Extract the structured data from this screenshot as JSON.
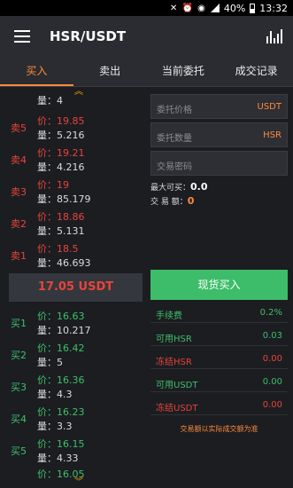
{
  "status_bar": {
    "battery": "40%",
    "time": "13:32"
  },
  "header": {
    "title": "HSR/USDT"
  },
  "tabs": [
    "买入",
    "卖出",
    "当前委托",
    "成交记录"
  ],
  "order_book": {
    "partial_top_qty": "量：4",
    "asks": [
      {
        "side": "卖5",
        "price": "价：19.85",
        "qty": "量：5.216"
      },
      {
        "side": "卖4",
        "price": "价：19.21",
        "qty": "量：4.216"
      },
      {
        "side": "卖3",
        "price": "价：19",
        "qty": "量：85.179"
      },
      {
        "side": "卖2",
        "price": "价：18.86",
        "qty": "量：5.131"
      },
      {
        "side": "卖1",
        "price": "价：18.5",
        "qty": "量：46.693"
      }
    ],
    "last_price": "17.05 USDT",
    "bids": [
      {
        "side": "买1",
        "price": "价：16.63",
        "qty": "量：10.217"
      },
      {
        "side": "买2",
        "price": "价：16.42",
        "qty": "量：5"
      },
      {
        "side": "买3",
        "price": "价：16.36",
        "qty": "量：4.3"
      },
      {
        "side": "买4",
        "price": "价：16.23",
        "qty": "量：3.3"
      },
      {
        "side": "买5",
        "price": "价：16.15",
        "qty": "量：4.33"
      }
    ],
    "partial_bottom_price": "价：16.05"
  },
  "trade_form": {
    "price_placeholder": "委托价格",
    "price_unit": "USDT",
    "qty_placeholder": "委托数量",
    "qty_unit": "HSR",
    "password_placeholder": "交易密码",
    "max_buy_label": "最大可买：",
    "max_buy_value": "0.0",
    "amount_label": "交 易 额：",
    "amount_value": "0",
    "buy_button": "现货买入"
  },
  "account": [
    {
      "label": "手续费",
      "value": "0.2%"
    },
    {
      "label": "可用HSR",
      "value": "0.03"
    },
    {
      "label": "冻结HSR",
      "value": "0.00"
    },
    {
      "label": "可用USDT",
      "value": "0.00"
    },
    {
      "label": "冻结USDT",
      "value": "0.00"
    }
  ],
  "note": "交易额以实际成交额为准",
  "colors": {
    "accent": "#ff8a3c",
    "sell": "#e8443a",
    "buy": "#3fbf6b",
    "button": "#3dbd6a"
  }
}
